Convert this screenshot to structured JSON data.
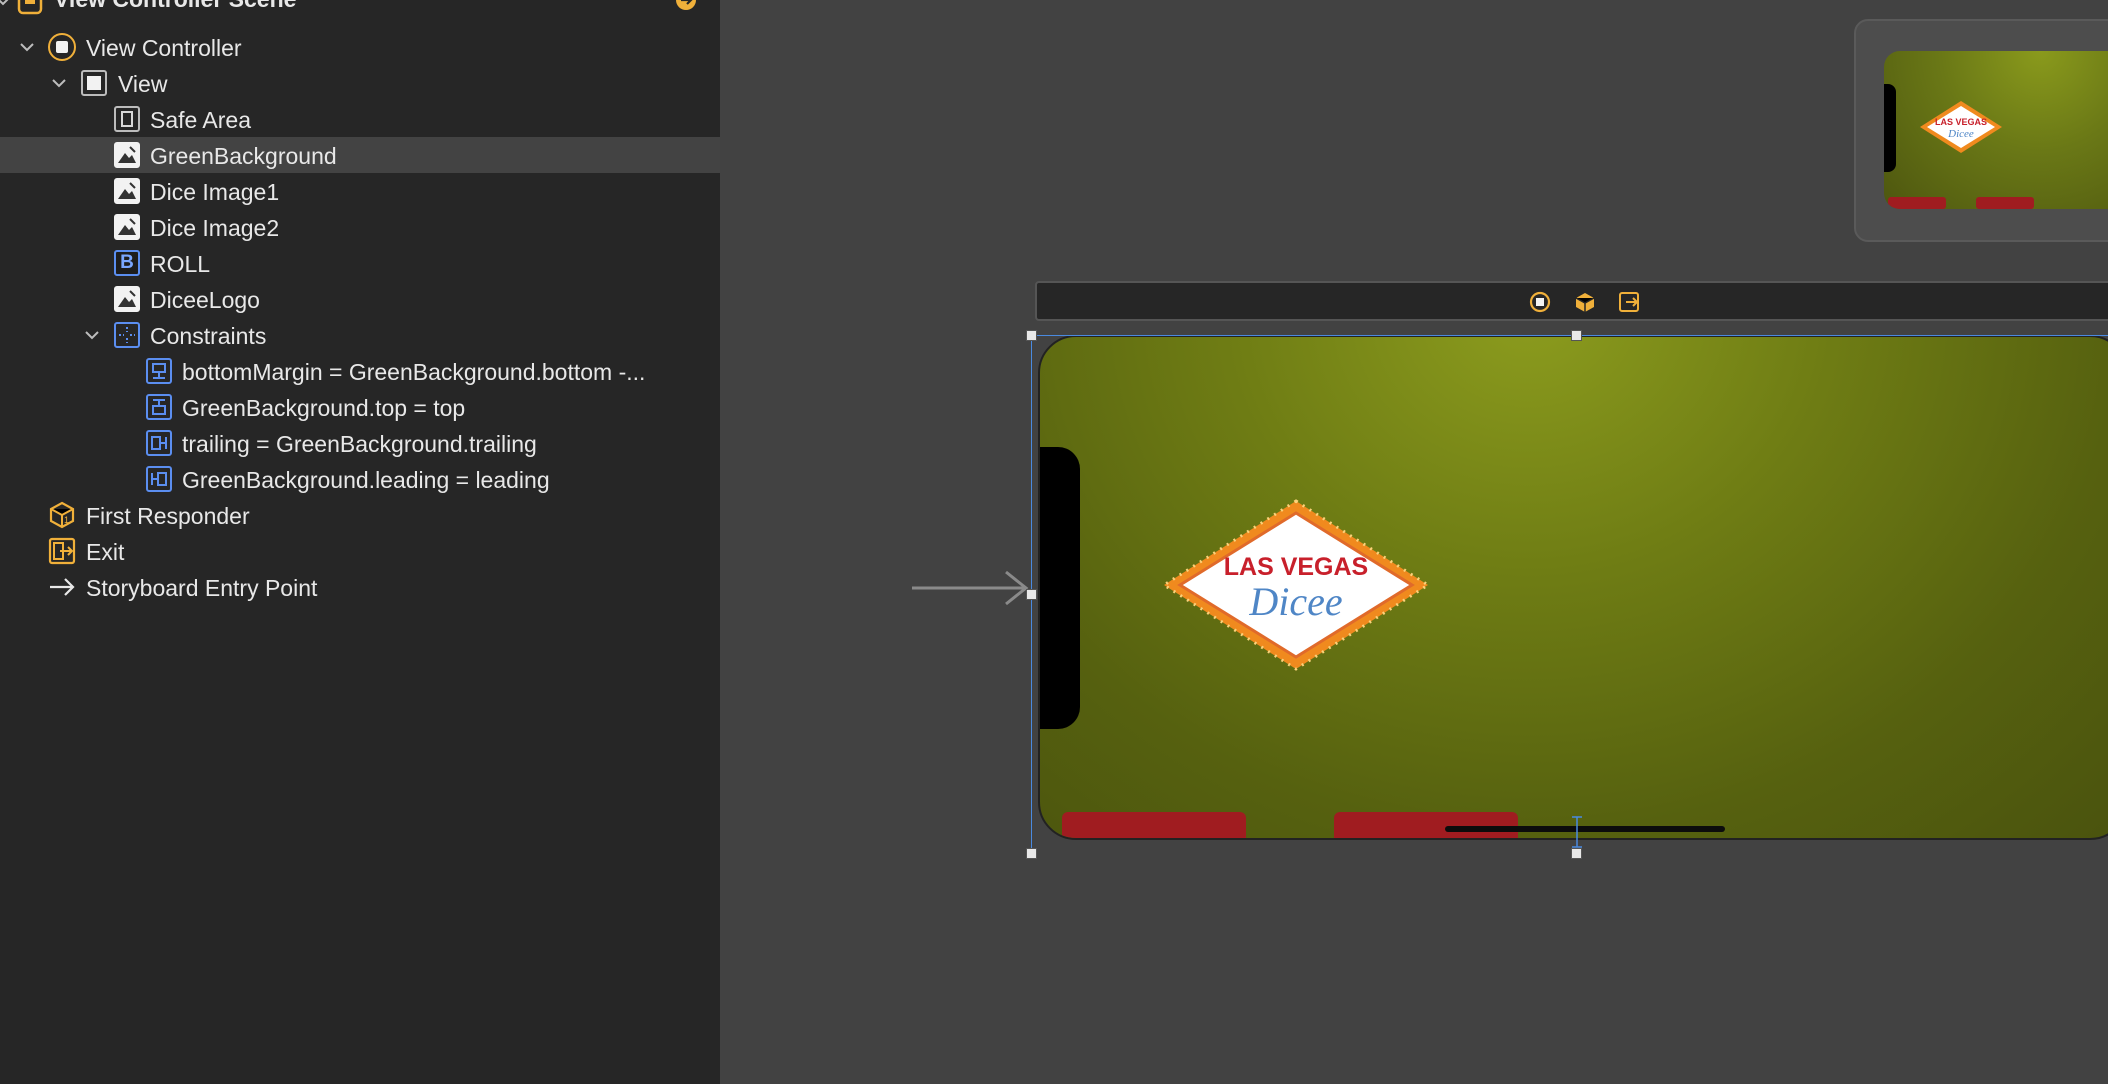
{
  "outline": {
    "scene_title": "View Controller Scene",
    "items": [
      {
        "label": "View Controller",
        "icon": "view-controller-icon"
      },
      {
        "label": "View",
        "icon": "view-icon"
      },
      {
        "label": "Safe Area",
        "icon": "safe-area-icon"
      },
      {
        "label": "GreenBackground",
        "icon": "image-view-icon"
      },
      {
        "label": "Dice Image1",
        "icon": "image-view-icon"
      },
      {
        "label": "Dice Image2",
        "icon": "image-view-icon"
      },
      {
        "label": "ROLL",
        "icon": "button-icon"
      },
      {
        "label": "DiceeLogo",
        "icon": "image-view-icon"
      },
      {
        "label": "Constraints",
        "icon": "constraints-icon"
      },
      {
        "label": "bottomMargin = GreenBackground.bottom -...",
        "icon": "constraint-bottom-icon"
      },
      {
        "label": "GreenBackground.top = top",
        "icon": "constraint-top-icon"
      },
      {
        "label": "trailing = GreenBackground.trailing",
        "icon": "constraint-trailing-icon"
      },
      {
        "label": "GreenBackground.leading = leading",
        "icon": "constraint-leading-icon"
      },
      {
        "label": "First Responder",
        "icon": "first-responder-icon"
      },
      {
        "label": "Exit",
        "icon": "exit-icon"
      },
      {
        "label": "Storyboard Entry Point",
        "icon": "arrow-right-icon"
      }
    ],
    "selected_index": 3,
    "button_glyph": "B"
  },
  "canvas": {
    "logo_line1": "LAS VEGAS",
    "logo_line2": "Dicee",
    "colors": {
      "felt_green": "#6f7d14",
      "felt_dark": "#4d560f",
      "roll_red": "#a01c20",
      "logo_red": "#c8202b",
      "logo_blue": "#4f86c6",
      "logo_orange": "#f08a1e",
      "accent_yellow": "#f0b03a",
      "selection_blue": "#4a8ae0"
    }
  }
}
